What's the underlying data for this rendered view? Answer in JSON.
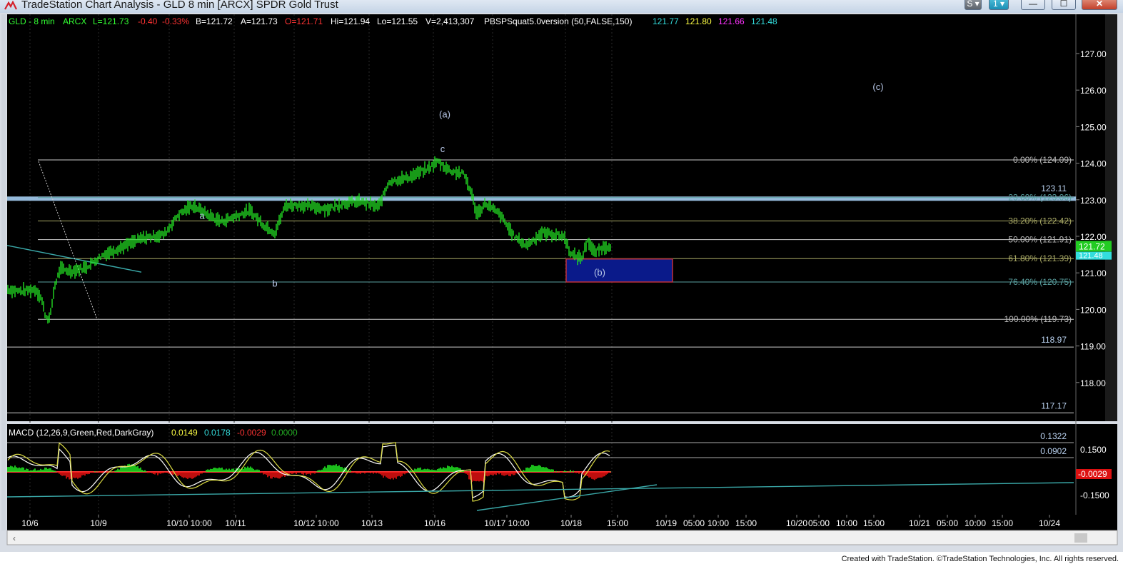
{
  "window": {
    "title": "TradeStation Chart Analysis - GLD 8 min [ARCX] SPDR Gold Trust",
    "buttons": {
      "s_label": "S",
      "one_label": "1",
      "minimize": "—",
      "maximize": "☐",
      "close": "✕"
    }
  },
  "header": {
    "symbol": "GLD - 8 min",
    "exchange": "ARCX",
    "last": "L=121.73",
    "change": "-0.40",
    "change_pct": "-0.33%",
    "bid": "B=121.72",
    "ask": "A=121.73",
    "open": "O=121.71",
    "high": "Hi=121.94",
    "low": "Lo=121.55",
    "volume": "V=2,413,307",
    "indicator": "PBSPSquat5.0version (50,FALSE,150)",
    "ind_values": [
      "121.77",
      "121.80",
      "121.66",
      "121.48"
    ]
  },
  "macd_header": {
    "label": "MACD (12,26,9,Green,Red,DarkGray)",
    "values": [
      "0.0149",
      "0.0178",
      "-0.0029",
      "0.0000"
    ]
  },
  "price_axis": [
    "127.00",
    "126.00",
    "125.00",
    "124.00",
    "123.00",
    "122.00",
    "121.00",
    "120.00",
    "119.00",
    "118.00"
  ],
  "macd_axis": [
    "0.1500",
    "-0.1500"
  ],
  "last_price_box": "121.72",
  "last_price_box2": "121.48",
  "macd_last_box": "-0.0029",
  "levels": [
    {
      "label": "0.00% (124.09)",
      "price": 124.09
    },
    {
      "label": "23.60% (123.06)",
      "price": 123.06
    },
    {
      "label": "38.20% (122.42)",
      "price": 122.42
    },
    {
      "label": "50.00% (121.91)",
      "price": 121.91
    },
    {
      "label": "61.80% (121.39)",
      "price": 121.39
    },
    {
      "label": "76.40% (120.75)",
      "price": 120.75
    },
    {
      "label": "100.00% (119.73)",
      "price": 119.73
    }
  ],
  "horizontal_lines": [
    {
      "label": "123.11",
      "price": 123.11
    },
    {
      "label": "118.97",
      "price": 118.97
    },
    {
      "label": "117.17",
      "price": 117.17
    }
  ],
  "macd_line_label": "0.0902",
  "macd_partial_label": "0.1322",
  "wave_labels": [
    "a",
    "b",
    "(a)",
    "c",
    "(b)",
    "(c)"
  ],
  "time_axis": [
    "10/6",
    "10/9",
    "10/10 10:00",
    "10/11",
    "10/12 10:00",
    "10/13",
    "10/16",
    "10/17 10:00",
    "10/18",
    "15:00",
    "10/19",
    "05:00",
    "10:00",
    "15:00",
    "10/20",
    "05:00",
    "10:00",
    "15:00",
    "10/21",
    "05:00",
    "10:00",
    "15:00",
    "10/24"
  ],
  "footer": "Created with TradeStation. ©TradeStation Technologies, Inc. All rights reserved.",
  "colors": {
    "background": "#000000",
    "price_bars": "#22dd22",
    "fib_lines": "#666666",
    "support_band": "#9cc3e6",
    "target_box_fill": "#0a1a8a",
    "target_box_border": "#c0303a",
    "trendline": "#3aa8a8",
    "macd_hist_pos": "#22ee22",
    "macd_hist_neg": "#ee1111",
    "macd_line": "#dddd44",
    "signal_line": "#ffffff"
  }
}
